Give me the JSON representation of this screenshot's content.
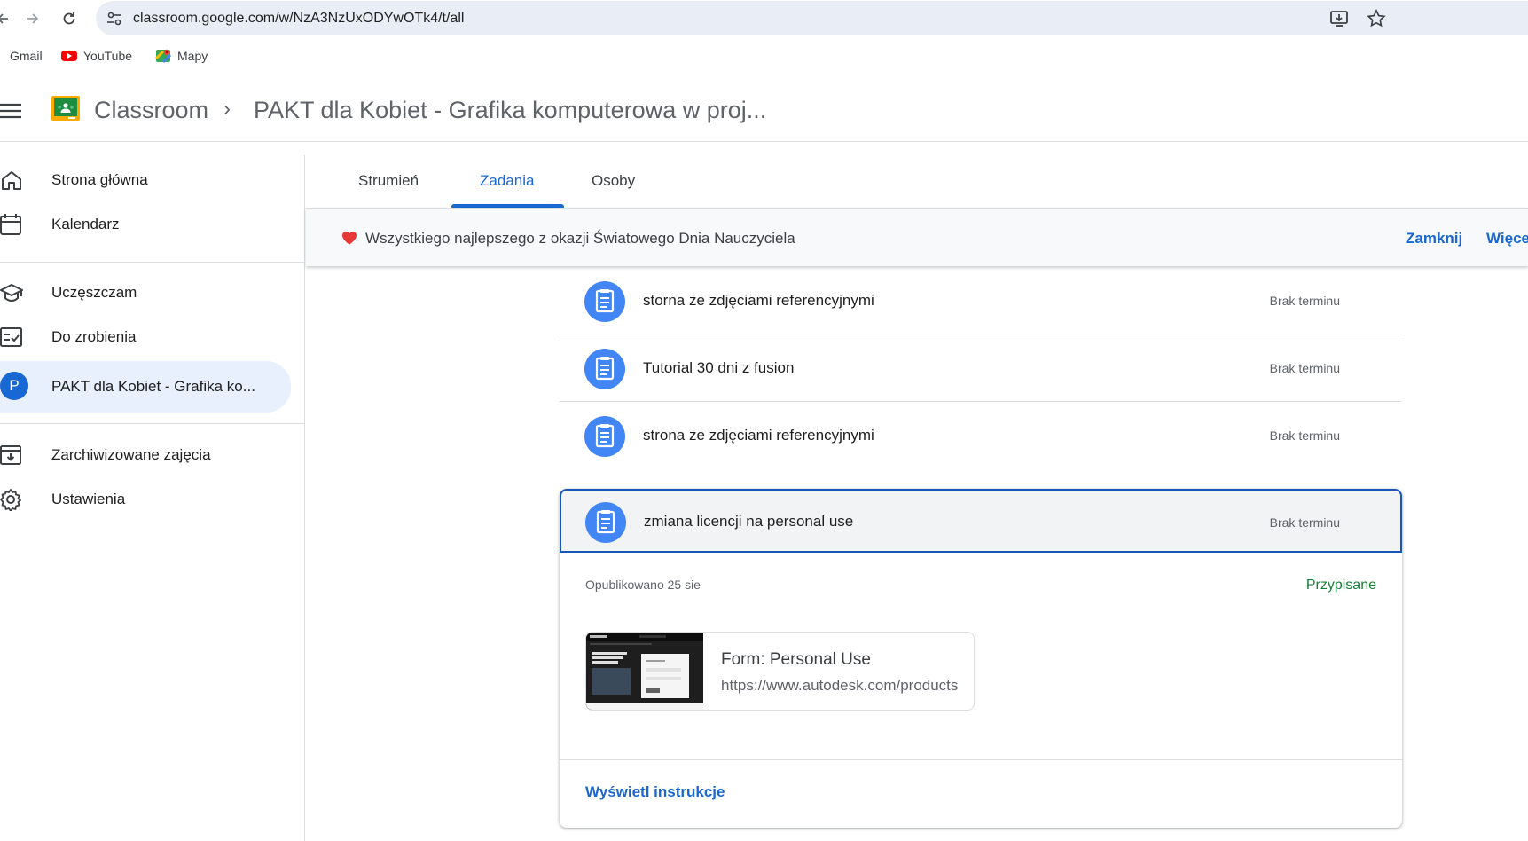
{
  "browser": {
    "url": "classroom.google.com/w/NzA3NzUxODYwOTk4/t/all",
    "bookmarks": [
      {
        "label": "Gmail",
        "icon": "gmail-icon"
      },
      {
        "label": "YouTube",
        "icon": "youtube-icon"
      },
      {
        "label": "Mapy",
        "icon": "maps-icon"
      }
    ]
  },
  "header": {
    "app_title": "Classroom",
    "separator": "›",
    "course_title": "PAKT dla Kobiet - Grafika komputerowa w proj..."
  },
  "sidebar": {
    "items": [
      {
        "label": "Strona główna",
        "icon": "home-icon"
      },
      {
        "label": "Kalendarz",
        "icon": "calendar-icon"
      },
      {
        "label": "Uczęszczam",
        "icon": "school-icon"
      },
      {
        "label": "Do zrobienia",
        "icon": "todo-icon"
      },
      {
        "label": "PAKT dla Kobiet - Grafika ko...",
        "avatar": "P",
        "active": true
      },
      {
        "label": "Zarchiwizowane zajęcia",
        "icon": "archive-icon"
      },
      {
        "label": "Ustawienia",
        "icon": "gear-icon"
      }
    ]
  },
  "tabs": [
    {
      "label": "Strumień"
    },
    {
      "label": "Zadania",
      "active": true
    },
    {
      "label": "Osoby"
    }
  ],
  "banner": {
    "text": "Wszystkiego najlepszego z okazji Światowego Dnia Nauczyciela",
    "close_label": "Zamknij",
    "more_label": "Więce"
  },
  "assignments": [
    {
      "title": "storna ze zdjęciami referencyjnymi",
      "due": "Brak terminu"
    },
    {
      "title": "Tutorial 30 dni z fusion",
      "due": "Brak terminu"
    },
    {
      "title": "strona ze zdjęciami referencyjnymi",
      "due": "Brak terminu"
    }
  ],
  "expanded_assignment": {
    "title": "zmiana licencji na personal use",
    "due": "Brak terminu",
    "published": "Opublikowano 25 sie",
    "status": "Przypisane",
    "attachment": {
      "title": "Form: Personal Use",
      "url": "https://www.autodesk.com/products"
    },
    "instructions_label": "Wyświetl instrukcje"
  },
  "colors": {
    "accent": "#1967d2",
    "assignment_icon": "#4285f4",
    "status_green": "#188038",
    "active_bg": "#e8f0fe"
  }
}
